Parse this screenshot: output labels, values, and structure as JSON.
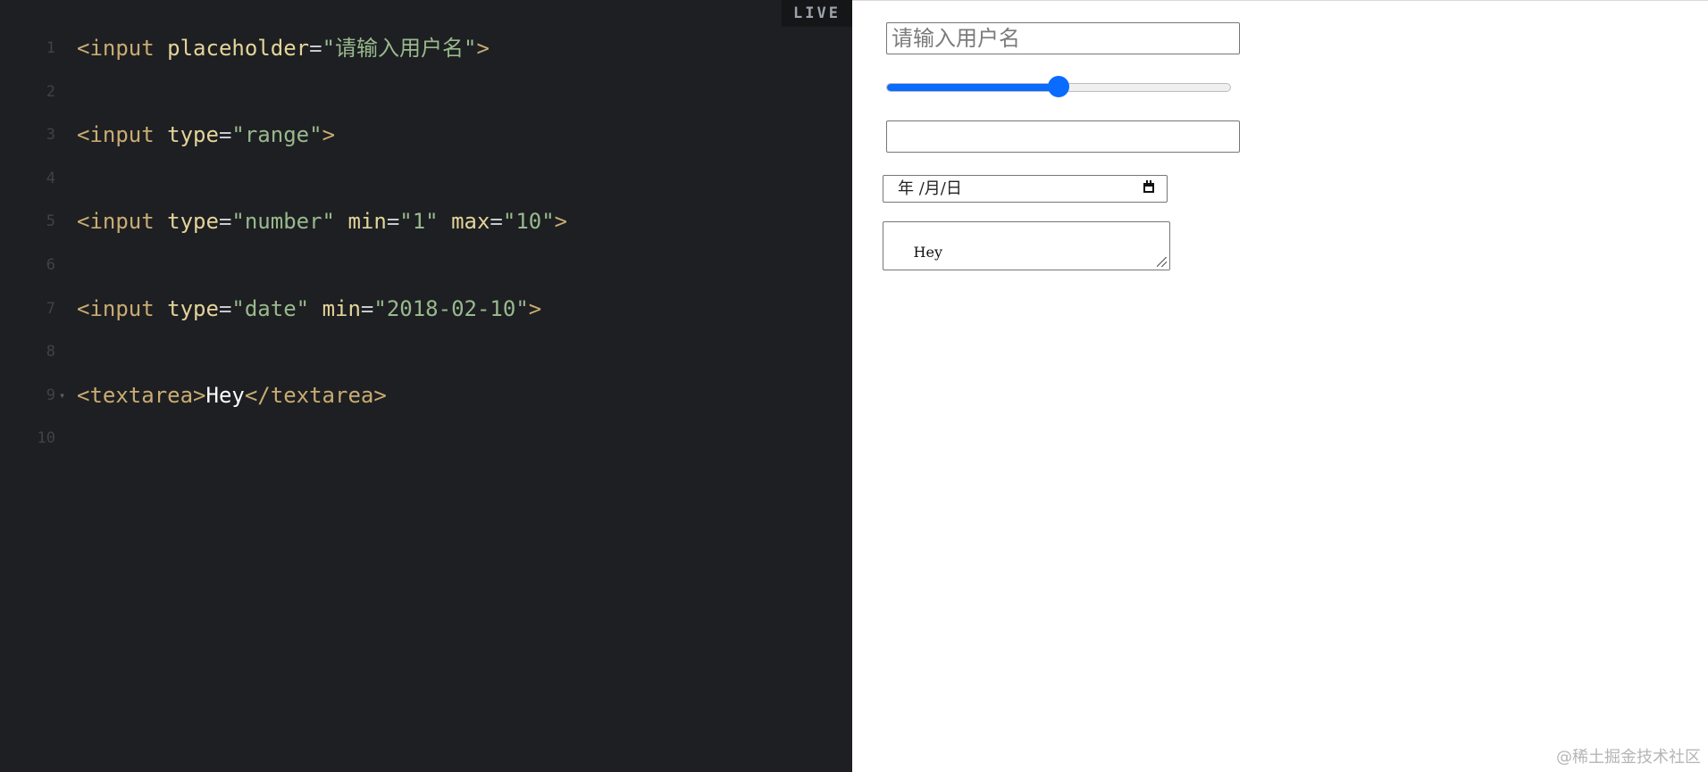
{
  "editor": {
    "live_badge": "LIVE",
    "lines": [
      {
        "number": "1",
        "parts": [
          {
            "type": "tag",
            "text": "<input "
          },
          {
            "type": "attr",
            "text": "placeholder"
          },
          {
            "type": "punct",
            "text": "="
          },
          {
            "type": "value",
            "text": "\"请输入用户名\""
          },
          {
            "type": "tag",
            "text": ">"
          }
        ]
      },
      {
        "number": "2",
        "parts": []
      },
      {
        "number": "3",
        "parts": [
          {
            "type": "tag",
            "text": "<input "
          },
          {
            "type": "attr",
            "text": "type"
          },
          {
            "type": "punct",
            "text": "="
          },
          {
            "type": "value",
            "text": "\"range\""
          },
          {
            "type": "tag",
            "text": ">"
          }
        ]
      },
      {
        "number": "4",
        "parts": []
      },
      {
        "number": "5",
        "parts": [
          {
            "type": "tag",
            "text": "<input "
          },
          {
            "type": "attr",
            "text": "type"
          },
          {
            "type": "punct",
            "text": "="
          },
          {
            "type": "value",
            "text": "\"number\" "
          },
          {
            "type": "attr",
            "text": "min"
          },
          {
            "type": "punct",
            "text": "="
          },
          {
            "type": "value",
            "text": "\"1\" "
          },
          {
            "type": "attr",
            "text": "max"
          },
          {
            "type": "punct",
            "text": "="
          },
          {
            "type": "value",
            "text": "\"10\""
          },
          {
            "type": "tag",
            "text": ">"
          }
        ]
      },
      {
        "number": "6",
        "parts": []
      },
      {
        "number": "7",
        "parts": [
          {
            "type": "tag",
            "text": "<input "
          },
          {
            "type": "attr",
            "text": "type"
          },
          {
            "type": "punct",
            "text": "="
          },
          {
            "type": "value",
            "text": "\"date\" "
          },
          {
            "type": "attr",
            "text": "min"
          },
          {
            "type": "punct",
            "text": "="
          },
          {
            "type": "value",
            "text": "\"2018-02-10\""
          },
          {
            "type": "tag",
            "text": ">"
          }
        ]
      },
      {
        "number": "8",
        "parts": []
      },
      {
        "number": "9",
        "fold_marker": "▾",
        "parts": [
          {
            "type": "tag",
            "text": "<textarea>"
          },
          {
            "type": "text",
            "text": "Hey"
          },
          {
            "type": "tag",
            "text": "</textarea>"
          }
        ]
      },
      {
        "number": "10",
        "parts": []
      }
    ]
  },
  "preview": {
    "text_input": {
      "placeholder": "请输入用户名",
      "value": ""
    },
    "range": {
      "value_fraction": 0.5
    },
    "number_input": {
      "value": ""
    },
    "date_input": {
      "placeholder": "年 /月/日",
      "icon": "calendar-icon"
    },
    "textarea": {
      "value": "Hey"
    }
  },
  "watermark": "@稀土掘金技术社区",
  "colors": {
    "editor_background": "#1e1f22",
    "tag": "#c8ac72",
    "attribute": "#e3d49a",
    "string": "#98b98d",
    "accent": "#0a6cff"
  }
}
